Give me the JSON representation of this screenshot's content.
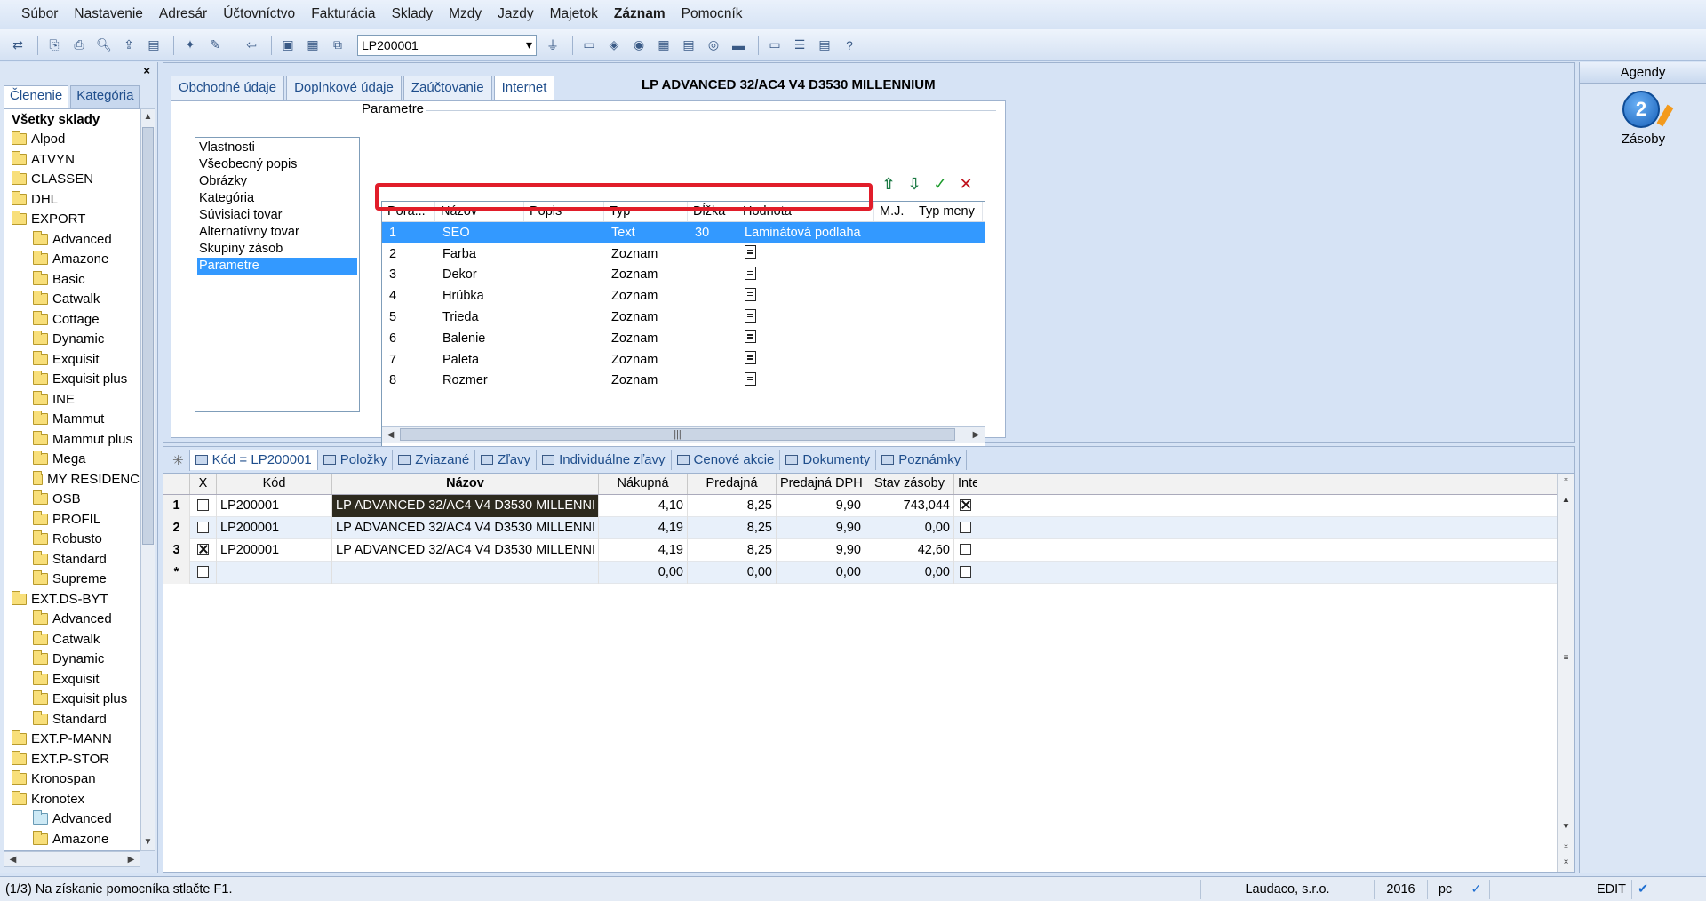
{
  "menu": [
    "Súbor",
    "Nastavenie",
    "Adresár",
    "Účtovníctvo",
    "Fakturácia",
    "Sklady",
    "Mzdy",
    "Jazdy",
    "Majetok",
    "Záznam",
    "Pomocník"
  ],
  "toolbar": {
    "record_combo_value": "LP200001"
  },
  "left_panel": {
    "close_glyph": "×",
    "tabs": [
      "Členenie",
      "Kategória"
    ],
    "tree": [
      {
        "label": "Všetky sklady",
        "level": "root"
      },
      {
        "label": "Alpod",
        "level": "l1"
      },
      {
        "label": "ATVYN",
        "level": "l1"
      },
      {
        "label": "CLASSEN",
        "level": "l1"
      },
      {
        "label": "DHL",
        "level": "l1"
      },
      {
        "label": "EXPORT",
        "level": "l1"
      },
      {
        "label": "Advanced",
        "level": "l2"
      },
      {
        "label": "Amazone",
        "level": "l2"
      },
      {
        "label": "Basic",
        "level": "l2"
      },
      {
        "label": "Catwalk",
        "level": "l2"
      },
      {
        "label": "Cottage",
        "level": "l2"
      },
      {
        "label": "Dynamic",
        "level": "l2"
      },
      {
        "label": "Exquisit",
        "level": "l2"
      },
      {
        "label": "Exquisit plus",
        "level": "l2"
      },
      {
        "label": "INE",
        "level": "l2"
      },
      {
        "label": "Mammut",
        "level": "l2"
      },
      {
        "label": "Mammut plus",
        "level": "l2"
      },
      {
        "label": "Mega",
        "level": "l2"
      },
      {
        "label": "MY RESIDENC",
        "level": "l2"
      },
      {
        "label": "OSB",
        "level": "l2"
      },
      {
        "label": "PROFIL",
        "level": "l2"
      },
      {
        "label": "Robusto",
        "level": "l2"
      },
      {
        "label": "Standard",
        "level": "l2"
      },
      {
        "label": "Supreme",
        "level": "l2"
      },
      {
        "label": "EXT.DS-BYT",
        "level": "l1"
      },
      {
        "label": "Advanced",
        "level": "l2"
      },
      {
        "label": "Catwalk",
        "level": "l2"
      },
      {
        "label": "Dynamic",
        "level": "l2"
      },
      {
        "label": "Exquisit",
        "level": "l2"
      },
      {
        "label": "Exquisit plus",
        "level": "l2"
      },
      {
        "label": "Standard",
        "level": "l2"
      },
      {
        "label": "EXT.P-MANN",
        "level": "l1"
      },
      {
        "label": "EXT.P-STOR",
        "level": "l1"
      },
      {
        "label": "Kronospan",
        "level": "l1"
      },
      {
        "label": "Kronotex",
        "level": "l1"
      },
      {
        "label": "Advanced",
        "level": "l2",
        "special": true
      },
      {
        "label": "Amazone",
        "level": "l2"
      }
    ]
  },
  "detail": {
    "tabs": [
      "Obchodné údaje",
      "Doplnkové údaje",
      "Zaúčtovanie",
      "Internet"
    ],
    "active_tab": "Internet",
    "product_title": "LP ADVANCED 32/AC4 V4 D3530 MILLENNIUM",
    "group_title": "Parametre",
    "categories": [
      "Vlastnosti",
      "Všeobecný popis",
      "Obrázky",
      "Kategória",
      "Súvisiaci tovar",
      "Alternatívny tovar",
      "Skupiny zásob",
      "Parametre"
    ],
    "selected_category": "Parametre",
    "param_columns": [
      "Pora...",
      "Názov",
      "Popis",
      "Typ",
      "Dĺžka",
      "Hodnota",
      "M.J.",
      "Typ meny"
    ],
    "param_rows": [
      {
        "poradie": "1",
        "nazov": "SEO",
        "popis": "",
        "typ": "Text",
        "dlzka": "30",
        "hodnota": "Laminátová podlaha",
        "icon": false
      },
      {
        "poradie": "2",
        "nazov": "Farba",
        "popis": "",
        "typ": "Zoznam",
        "dlzka": "",
        "hodnota": "",
        "icon": true
      },
      {
        "poradie": "3",
        "nazov": "Dekor",
        "popis": "",
        "typ": "Zoznam",
        "dlzka": "",
        "hodnota": "",
        "icon": true
      },
      {
        "poradie": "4",
        "nazov": "Hrúbka",
        "popis": "",
        "typ": "Zoznam",
        "dlzka": "",
        "hodnota": "",
        "icon": true
      },
      {
        "poradie": "5",
        "nazov": "Trieda",
        "popis": "",
        "typ": "Zoznam",
        "dlzka": "",
        "hodnota": "",
        "icon": true
      },
      {
        "poradie": "6",
        "nazov": "Balenie",
        "popis": "",
        "typ": "Zoznam",
        "dlzka": "",
        "hodnota": "",
        "icon": true
      },
      {
        "poradie": "7",
        "nazov": "Paleta",
        "popis": "",
        "typ": "Zoznam",
        "dlzka": "",
        "hodnota": "",
        "icon": true
      },
      {
        "poradie": "8",
        "nazov": "Rozmer",
        "popis": "",
        "typ": "Zoznam",
        "dlzka": "",
        "hodnota": "",
        "icon": true
      }
    ]
  },
  "agendy": {
    "title": "Agendy",
    "item_label": "Zásoby"
  },
  "bottom": {
    "tabs": [
      "Kód = LP200001",
      "Položky",
      "Zviazané",
      "Zľavy",
      "Individuálne zľavy",
      "Cenové akcie",
      "Dokumenty",
      "Poznámky"
    ],
    "columns": [
      "X",
      "Kód",
      "Názov",
      "Nákupná",
      "Predajná",
      "Predajná DPH",
      "Stav zásoby",
      "Inte"
    ],
    "rows": [
      {
        "num": "1",
        "x": false,
        "kod": "LP200001",
        "nazov": "LP ADVANCED 32/AC4 V4 D3530 MILLENNI",
        "nakupna": "4,10",
        "predajna": "8,25",
        "predajna_dph": "9,90",
        "stav": "743,044",
        "inte": true
      },
      {
        "num": "2",
        "x": false,
        "kod": "LP200001",
        "nazov": "LP ADVANCED 32/AC4 V4 D3530 MILLENNI",
        "nakupna": "4,19",
        "predajna": "8,25",
        "predajna_dph": "9,90",
        "stav": "0,00",
        "inte": false
      },
      {
        "num": "3",
        "x": true,
        "kod": "LP200001",
        "nazov": "LP ADVANCED 32/AC4 V4 D3530 MILLENNI",
        "nakupna": "4,19",
        "predajna": "8,25",
        "predajna_dph": "9,90",
        "stav": "42,60",
        "inte": false
      },
      {
        "num": "*",
        "x": false,
        "kod": "",
        "nazov": "",
        "nakupna": "0,00",
        "predajna": "0,00",
        "predajna_dph": "0,00",
        "stav": "0,00",
        "inte": false
      }
    ]
  },
  "status": {
    "message": "(1/3) Na získanie pomocníka stlačte F1.",
    "company": "Laudaco, s.r.o.",
    "year": "2016",
    "user": "pc",
    "mode": "EDIT"
  },
  "colors": {
    "selection": "#3399ff",
    "highlight_box": "#e11d2a"
  }
}
